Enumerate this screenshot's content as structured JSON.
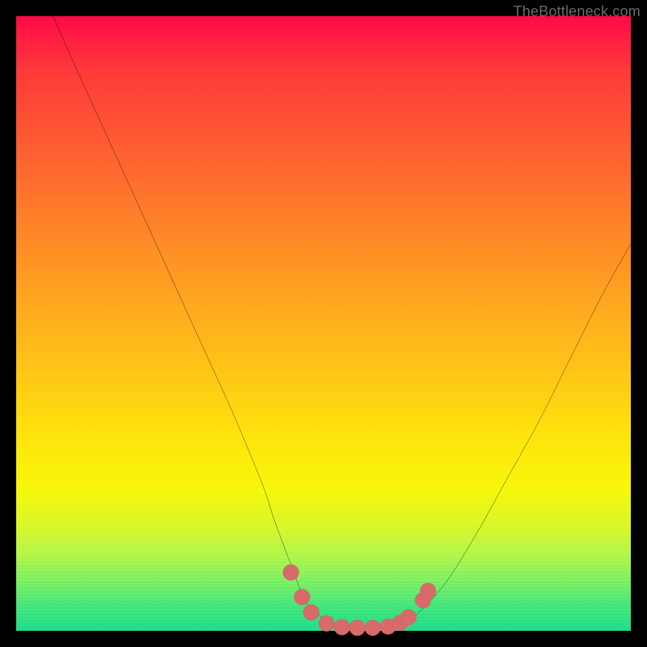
{
  "watermark": "TheBottleneck.com",
  "colors": {
    "page_bg": "#000000",
    "gradient_top": "#ff0a48",
    "gradient_bottom": "#20de8e",
    "curve_stroke": "#000000",
    "marker_fill": "#d86a6a",
    "marker_stroke": "#c05555"
  },
  "chart_data": {
    "type": "line",
    "title": "",
    "xlabel": "",
    "ylabel": "",
    "xlim": [
      0,
      100
    ],
    "ylim": [
      0,
      100
    ],
    "grid": false,
    "legend": false,
    "series": [
      {
        "name": "curve",
        "x": [
          6,
          10,
          15,
          20,
          25,
          30,
          35,
          40,
          42,
          45,
          47,
          50,
          53,
          56,
          60,
          62,
          65,
          70,
          75,
          80,
          85,
          90,
          95,
          100
        ],
        "y": [
          100,
          91,
          80,
          69,
          58,
          47,
          36,
          24,
          18,
          10,
          5,
          2,
          0.8,
          0.5,
          0.5,
          0.9,
          2.5,
          8,
          16,
          25,
          34,
          44,
          54,
          63
        ]
      }
    ],
    "markers": [
      {
        "x": 44.7,
        "y": 9.5
      },
      {
        "x": 46.5,
        "y": 5.5
      },
      {
        "x": 48.0,
        "y": 3.0
      },
      {
        "x": 50.5,
        "y": 1.2
      },
      {
        "x": 53.0,
        "y": 0.6
      },
      {
        "x": 55.5,
        "y": 0.5
      },
      {
        "x": 58.0,
        "y": 0.5
      },
      {
        "x": 60.5,
        "y": 0.7
      },
      {
        "x": 62.5,
        "y": 1.3
      },
      {
        "x": 63.8,
        "y": 2.2
      },
      {
        "x": 66.2,
        "y": 5.0
      },
      {
        "x": 67.0,
        "y": 6.5
      }
    ]
  }
}
